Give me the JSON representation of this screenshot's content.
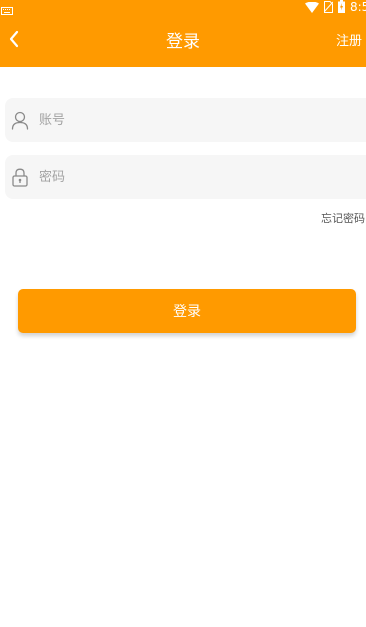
{
  "colors": {
    "accent": "#ff9a00",
    "field_background": "#f6f6f6",
    "placeholder": "#a3a3a3"
  },
  "status_bar": {
    "time": "8:5",
    "icons": [
      "keyboard-icon",
      "wifi-icon",
      "no-sim-icon",
      "battery-icon"
    ]
  },
  "nav": {
    "back_icon": "chevron-left-icon",
    "title": "登录",
    "register_label": "注册"
  },
  "form": {
    "account": {
      "icon": "user-icon",
      "placeholder": "账号",
      "value": ""
    },
    "password": {
      "icon": "lock-icon",
      "placeholder": "密码",
      "value": ""
    },
    "forgot_label": "忘记密码",
    "submit_label": "登录"
  }
}
